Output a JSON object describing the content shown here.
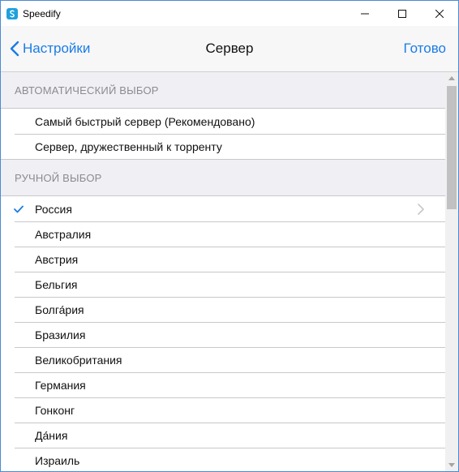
{
  "window": {
    "title": "Speedify"
  },
  "nav": {
    "back_label": "Настройки",
    "title": "Сервер",
    "done_label": "Готово"
  },
  "auto_section": {
    "header": "АВТОМАТИЧЕСКИЙ ВЫБОР",
    "items": [
      {
        "label": "Самый быстрый сервер (Рекомендовано)"
      },
      {
        "label": "Сервер, дружественный к торренту"
      }
    ]
  },
  "manual_section": {
    "header": "РУЧНОЙ ВЫБОР",
    "items": [
      {
        "label": "Россия",
        "selected": true
      },
      {
        "label": "Австралия"
      },
      {
        "label": "Австрия"
      },
      {
        "label": "Бельгия"
      },
      {
        "label": "Болга́рия"
      },
      {
        "label": "Бразилия"
      },
      {
        "label": "Великобритания"
      },
      {
        "label": "Германия"
      },
      {
        "label": "Гонконг"
      },
      {
        "label": "Да́ния"
      },
      {
        "label": "Израиль"
      }
    ]
  },
  "colors": {
    "accent": "#1a7ce6",
    "section_bg": "#efeff4",
    "separator": "#c8c7cc"
  }
}
